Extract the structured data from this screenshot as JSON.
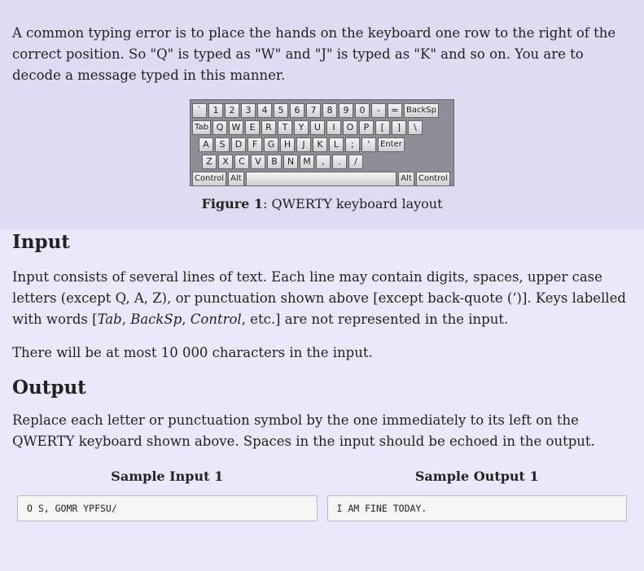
{
  "intro": "A common typing error is to place the hands on the keyboard one row to the right of the correct position. So \"Q\" is typed as \"W\" and \"J\" is typed as \"K\" and so on. You are to decode a message typed in this manner.",
  "keyboard": {
    "row1": [
      "`",
      "1",
      "2",
      "3",
      "4",
      "5",
      "6",
      "7",
      "8",
      "9",
      "0",
      "-",
      "=",
      "BackSp"
    ],
    "row2": [
      "Tab",
      "Q",
      "W",
      "E",
      "R",
      "T",
      "Y",
      "U",
      "I",
      "O",
      "P",
      "[",
      "]",
      "\\"
    ],
    "row3": [
      "A",
      "S",
      "D",
      "F",
      "G",
      "H",
      "J",
      "K",
      "L",
      ";",
      "'",
      "Enter"
    ],
    "row4": [
      "Z",
      "X",
      "C",
      "V",
      "B",
      "N",
      "M",
      ",",
      ".",
      "/"
    ],
    "row5": [
      "Control",
      "Alt",
      "",
      "Alt",
      "Control"
    ]
  },
  "figure": {
    "label": "Figure 1",
    "caption": ": QWERTY keyboard layout"
  },
  "input_section": {
    "heading": "Input",
    "p1_a": "Input consists of several lines of text. Each line may contain digits, spaces, upper case letters (except Q, A, Z), or punctuation shown above [except back-quote (‘)]. Keys labelled with words [",
    "p1_i1": "Tab",
    "p1_s1": ", ",
    "p1_i2": "BackSp",
    "p1_s2": ", ",
    "p1_i3": "Control",
    "p1_b": ", etc.] are not represented in the input.",
    "p2": "There will be at most 10 000 characters in the input."
  },
  "output_section": {
    "heading": "Output",
    "p1": "Replace each letter or punctuation symbol by the one immediately to its left on the QWERTY keyboard shown above. Spaces in the input should be echoed in the output."
  },
  "samples": {
    "input_title": "Sample Input 1",
    "input_text": "O S, GOMR YPFSU/",
    "output_title": "Sample Output 1",
    "output_text": "I AM FINE TODAY."
  }
}
